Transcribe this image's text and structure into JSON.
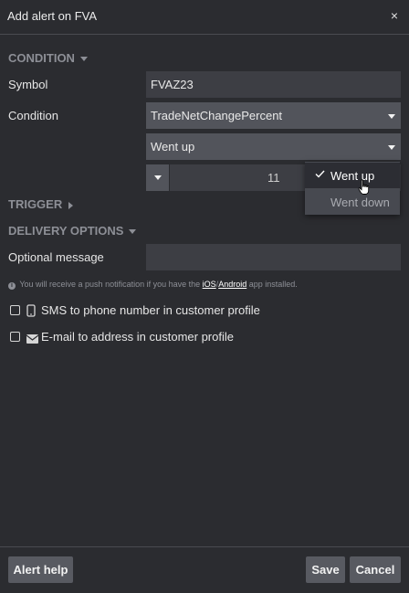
{
  "dialog": {
    "title": "Add alert on FVA",
    "close_glyph": "×"
  },
  "condition_section": {
    "heading": "CONDITION"
  },
  "symbol": {
    "label": "Symbol",
    "value": "FVAZ23"
  },
  "condition": {
    "label": "Condition",
    "type_value": "TradeNetChangePercent",
    "direction_value": "Went up",
    "threshold_value": "11"
  },
  "direction_dropdown": {
    "options": [
      {
        "label": "Went up",
        "selected": true
      },
      {
        "label": "Went down",
        "selected": false
      }
    ]
  },
  "trigger_section": {
    "heading": "TRIGGER"
  },
  "delivery_section": {
    "heading": "DELIVERY OPTIONS"
  },
  "message": {
    "label": "Optional message",
    "value": ""
  },
  "push_info": {
    "prefix": "You will receive a push notification if you have the",
    "ios_link": "iOS",
    "separator": "/",
    "android_link": "Android",
    "suffix": "app installed."
  },
  "options": {
    "sms": {
      "label": "SMS to phone number in customer profile",
      "icon": "phone-icon",
      "checked": false
    },
    "email": {
      "label": "E-mail to address in customer profile",
      "icon": "envelope-icon",
      "checked": false
    }
  },
  "footer": {
    "help_label": "Alert help",
    "save_label": "Save",
    "cancel_label": "Cancel"
  },
  "colors": {
    "background": "#2b2c30",
    "field": "#3d3e44",
    "select": "#52545b",
    "button": "#585a61",
    "muted_text": "#8d8f96"
  }
}
